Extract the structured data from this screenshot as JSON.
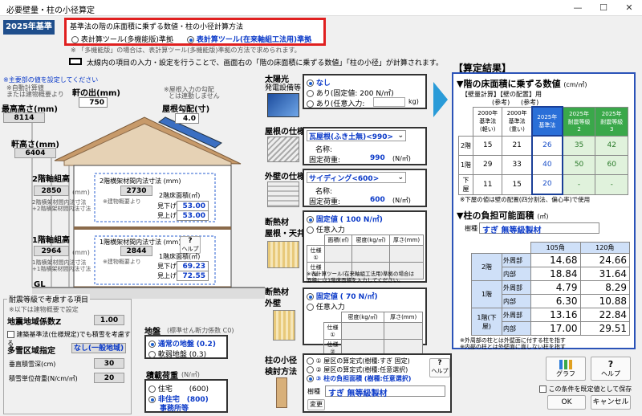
{
  "window": {
    "title": "必要壁量・柱の小径算定"
  },
  "std_button": "2025年基準",
  "method": {
    "heading": "基準法の階の床面積に乗ずる数値・柱の小径計算方法",
    "opt1": "表計算ツール(多機能版)準拠",
    "opt2": "表計算ツール(在来軸組工法用)準拠",
    "note": "※ 「多機能版」の場合は、表計算ツール(多機能版)準拠の方法で求められます。"
  },
  "info_text": "太線内の項目の入力・設定を行うことで、画面右の「階の床面積に乗ずる数値」「柱の小径」が計算されます。",
  "main_parts_note": "※主要部の値を設定してください",
  "left_notes": {
    "auto": "※自動計算値",
    "auto2": "または建物概要より"
  },
  "noki": {
    "label": "軒の出(mm)",
    "value": "750"
  },
  "koubai_note1": "※屋根入力の勾配",
  "koubai_note2": "とは連動しません",
  "koubai": {
    "label": "屋根勾配(寸)",
    "value": "4.0"
  },
  "max_height": {
    "label": "最高高さ(mm)",
    "value": "8114"
  },
  "eave_height": {
    "label": "軒高さ(mm)",
    "value": "6404"
  },
  "f2": {
    "label": "2階軸組高",
    "value": "2850",
    "unit": "(mm)",
    "sub1": "2階横架材間内法寸法",
    "sub2": "+2階横架材間内法寸法",
    "inner_label": "2階横架材間内法寸法 (mm)",
    "inner_value": "2730",
    "note": "※建物概要より",
    "area_label": "2階床面積(㎡)",
    "mitate_label": "見下げ",
    "mitate": "53.00",
    "miage_label": "見上げ",
    "miage": "53.00"
  },
  "f1": {
    "label": "1階軸組高",
    "value": "2964",
    "unit": "(mm)",
    "sub1": "1階横架材間内法寸法",
    "sub2": "+1階横架材間内法寸法",
    "inner_label": "1階横架材間内法寸法 (mm)",
    "inner_value": "2844",
    "note": "※建物概要より",
    "area_label": "1階床面積(㎡)",
    "mitate_label": "見下げ",
    "mitate": "69.23",
    "miage_label": "見上げ",
    "miage": "72.55",
    "help": "ヘルプ"
  },
  "gl": "GL",
  "seismic": {
    "title": "耐震等級で考慮する項目",
    "note": "※以下は建物概要で設定",
    "z_label": "地震地域係数Z",
    "z_value": "1.00",
    "chk_label": "建築基準法(仕様規定)でも積雪を考慮する",
    "snow_label": "多雪区域指定",
    "snow_value": "なし(一般地域)",
    "depth_label": "垂直積雪深(cm)",
    "depth_value": "30",
    "unit_label": "積雪単位荷重(N/cm/㎡)",
    "unit_value": "20"
  },
  "ground": {
    "label": "地盤",
    "label_sub": "(標準せん断力係数 C0)",
    "opt1": "通常の地盤",
    "opt1_val": "(0.2)",
    "opt2": "軟弱地盤",
    "opt2_val": "(0.3)"
  },
  "snowload": {
    "label": "積載荷重",
    "unit": "(N/㎡)",
    "opt1": "住宅",
    "opt1_val": "(600)",
    "opt2": "非住宅",
    "opt2_val": "(800)",
    "opt2_b": "事務所等"
  },
  "solar": {
    "label1": "太陽光",
    "label2": "発電設備等",
    "opt1": "なし",
    "opt2": "あり(固定値:",
    "opt2_val": "200 N/㎡)",
    "opt3": "あり(任意入力:",
    "opt3_unit": "kg)"
  },
  "roof": {
    "label": "屋根の仕様",
    "select": "瓦屋根(ふき土無)<990>",
    "name_label": "名称:",
    "load_label": "固定荷重:",
    "load": "990",
    "unit": "(N/㎡)"
  },
  "wall": {
    "label": "外壁の仕様",
    "select": "サイディング<600>",
    "name_label": "名称:",
    "load_label": "固定荷重:",
    "load": "600",
    "unit": "(N/㎡)"
  },
  "ins_roof": {
    "label1": "断熱材",
    "label2": "屋根・天井",
    "opt1": "固定値",
    "opt1_val": "( 100 N/㎡)",
    "opt2": "任意入力",
    "cols": [
      "面積(㎡)",
      "密度(kg/㎥)",
      "厚さ(mm)"
    ],
    "rows": [
      "仕様①",
      "仕様②"
    ],
    "note1": "※表計算ツール(在来軸組工法用)準拠の場合は",
    "note2": "面積には1階床面積を入力してください。"
  },
  "ins_wall": {
    "label1": "断熱材",
    "label2": "外壁",
    "opt1": "固定値",
    "opt1_val": "( 70 N/㎡)",
    "opt2": "任意入力",
    "cols": [
      "密度(kg/㎥)",
      "厚さ(mm)"
    ],
    "rows": [
      "仕様①",
      "仕様②"
    ]
  },
  "column": {
    "label1": "柱の小径",
    "label2": "検討方法",
    "opt1": "① 屋区の算定式(樹種:すぎ 固定)",
    "opt2": "② 屋区の算定式(樹種:任意選択)",
    "opt3": "③ 柱の負担面積 (樹種:任意選択)",
    "help": "ヘルプ",
    "species_label": "樹種",
    "species": "すぎ 無等級製材",
    "change": "変更"
  },
  "result": {
    "title": "【算定結果】",
    "floor_title": "▼階の床面積に乗ずる数値",
    "floor_unit": "(cm/㎡)",
    "calc_note": "【壁量計算】【壁の配置】用",
    "ref1": "(参考)",
    "ref2": "(参考)",
    "headers": [
      "2000年\n基準法\n(軽い)",
      "2000年\n基準法\n(重い)",
      "2025年\n基準法",
      "2025年\n耐震等級\n2",
      "2025年\n耐震等級\n3"
    ],
    "rows": [
      {
        "label": "2階",
        "vals": [
          "15",
          "21",
          "26",
          "35",
          "42"
        ]
      },
      {
        "label": "1階",
        "vals": [
          "29",
          "33",
          "40",
          "50",
          "60"
        ]
      },
      {
        "label": "下屋",
        "vals": [
          "11",
          "15",
          "20",
          "-",
          "-"
        ]
      }
    ],
    "floor_note": "※下屋の値は壁の配置(四分割法、偏心率)で使用",
    "column_title": "▼柱の負担可能面積",
    "column_unit": "(㎡)",
    "species_label": "樹種",
    "species": "すぎ 無等級製材",
    "col_headers": [
      "105角",
      "120角"
    ],
    "col_rows": [
      {
        "floor": "2階",
        "part": "外周部",
        "v1": "14.68",
        "v2": "24.66"
      },
      {
        "floor": "",
        "part": "内部",
        "v1": "18.84",
        "v2": "31.64"
      },
      {
        "floor": "1階",
        "part": "外周部",
        "v1": "4.79",
        "v2": "8.29"
      },
      {
        "floor": "",
        "part": "内部",
        "v1": "6.30",
        "v2": "10.88"
      },
      {
        "floor": "1階(下屋)",
        "part": "外周部",
        "v1": "13.16",
        "v2": "22.84"
      },
      {
        "floor": "",
        "part": "内部",
        "v1": "17.00",
        "v2": "29.51"
      }
    ],
    "col_note1": "※外周部の柱とは外壁面に付する柱を指す",
    "col_note2": "※内部の柱とは外壁面に面しない柱を指す"
  },
  "buttons": {
    "graph": "グラフ",
    "help": "ヘルプ",
    "save_label": "この条件を既定値として保存",
    "ok": "OK",
    "cancel": "キャンセル"
  }
}
